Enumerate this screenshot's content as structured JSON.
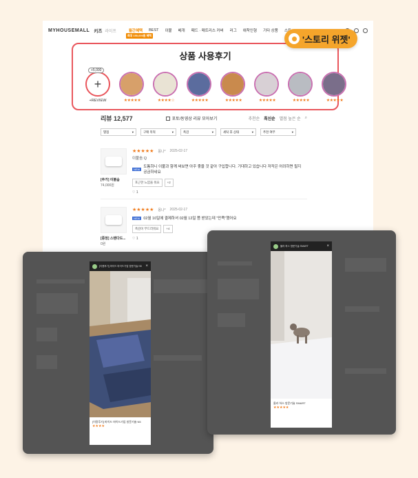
{
  "nav": {
    "logo": "MYHOUSEMALL",
    "category": "키즈",
    "category2": "라이프",
    "promo": "월간혜택",
    "promo_sub": "최대 150,000원 혜택",
    "items": [
      "BEST",
      "이불",
      "베개",
      "패드 · 매트리스 커버",
      "러그",
      "애착인형",
      "기타 상품",
      "스토"
    ]
  },
  "widget": {
    "title": "상품 사용후기",
    "add_badge": "+5,000",
    "add_label": "+REVIEW",
    "story_tag": "'스토리 위젯'",
    "thumbs": [
      {
        "stars": "★★★★★",
        "color": "#d7a06a"
      },
      {
        "stars": "★★★★☆",
        "color": "#e9e3d4"
      },
      {
        "stars": "★★★★★",
        "color": "#5b6c9e"
      },
      {
        "stars": "★★★★★",
        "color": "#c98a4d"
      },
      {
        "stars": "★★★★★",
        "color": "#d8d0d5"
      },
      {
        "stars": "★★★★★",
        "color": "#b9bcc2"
      },
      {
        "stars": "★★★★★",
        "color": "#7a6e8a"
      }
    ]
  },
  "reviews_header": {
    "count": "리뷰 12,577",
    "photo_filter": "포토/동영상 리뷰 모아보기",
    "sort": [
      "추천순",
      "최신순",
      "별점 높은 순"
    ]
  },
  "filters": [
    "별점",
    "구매 목적",
    "촉감",
    "세탁 후 상태",
    "추천 여부"
  ],
  "reviews": [
    {
      "product": "[추가] 이불솜",
      "price": "74,000원",
      "stars": "★★★★★",
      "who": "몽나*",
      "date": "2025-02-17",
      "option": "이불솜 Q",
      "badge": "NEW",
      "text": "도톰하니 이불과 함께 써보면 아주 좋을 것 같아 구입합니다. 기대하고 있습니다 저작은 어려하면 될지 궁금하네요",
      "chip1": "포근한 느낌을 줘요",
      "chip2": "+2",
      "likes": "1"
    },
    {
      "product": "[증정] 스탠다드...",
      "price": "0원",
      "stars": "★★★★★",
      "who": "몽나*",
      "date": "2025-02-17",
      "option": "",
      "badge": "NEW",
      "text": "02월 10일에 결제하셔 02월 12일 쯤 받았는데 \"만족\"했어요",
      "chip1": "촉감이 부드러워요",
      "chip2": "+4",
      "likes": "1"
    }
  ],
  "overlay1": {
    "header": "[이용후기] 마이드 마이드기업 방문기술 N5",
    "footer_title": "[이용후기] 마이드 마이드기업 방문기술 N5",
    "stars": "★★★★"
  },
  "overlay2": {
    "header": "몰라 하스 방문기술 SMART",
    "footer_title": "몰라 하스 방문기술 SMART",
    "stars": "★★★★★"
  }
}
